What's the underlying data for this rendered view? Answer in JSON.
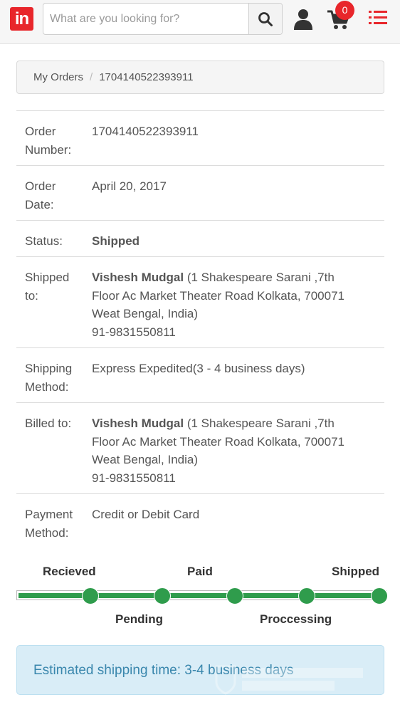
{
  "header": {
    "logo_text": "in",
    "search_placeholder": "What are you looking for?",
    "cart_count": "0",
    "icons": [
      "search-icon",
      "user-icon",
      "cart-icon",
      "menu-icon"
    ],
    "brand_color": "#e8262b"
  },
  "breadcrumb": {
    "parent": "My Orders",
    "current": "1704140522393911"
  },
  "order": {
    "number_label_1": "Order",
    "number_label_2": "Number:",
    "number": "1704140522393911",
    "date_label_1": "Order",
    "date_label_2": "Date:",
    "date": "April 20, 2017",
    "status_label": "Status:",
    "status": "Shipped",
    "shipped_label_1": "Shipped",
    "shipped_label_2": "to:",
    "shipped_name": "Vishesh Mudgal",
    "shipped_addr_1": " (1 Shakespeare Sarani ,7th",
    "shipped_addr_2": "Floor Ac Market Theater Road Kolkata, 700071",
    "shipped_addr_3": "Weat Bengal, India)",
    "shipped_phone": "91-9831550811",
    "method_label_1": "Shipping",
    "method_label_2": "Method:",
    "method": "Express Expedited(3 - 4 business days)",
    "billed_label": "Billed to:",
    "billed_name": "Vishesh Mudgal",
    "billed_addr_1": " (1 Shakespeare Sarani ,7th",
    "billed_addr_2": "Floor Ac Market Theater Road Kolkata, 700071",
    "billed_addr_3": "Weat Bengal, India)",
    "billed_phone": "91-9831550811",
    "payment_label_1": "Payment",
    "payment_label_2": "Method:",
    "payment": "Credit or Debit Card"
  },
  "tracker": {
    "steps": [
      "Recieved",
      "Pending",
      "Paid",
      "Proccessing",
      "Shipped"
    ],
    "progress": 1.0,
    "color": "#2f9c4c"
  },
  "alert": {
    "text": "Estimated shipping time: 3-4 business days",
    "color": "#d9edf7"
  }
}
